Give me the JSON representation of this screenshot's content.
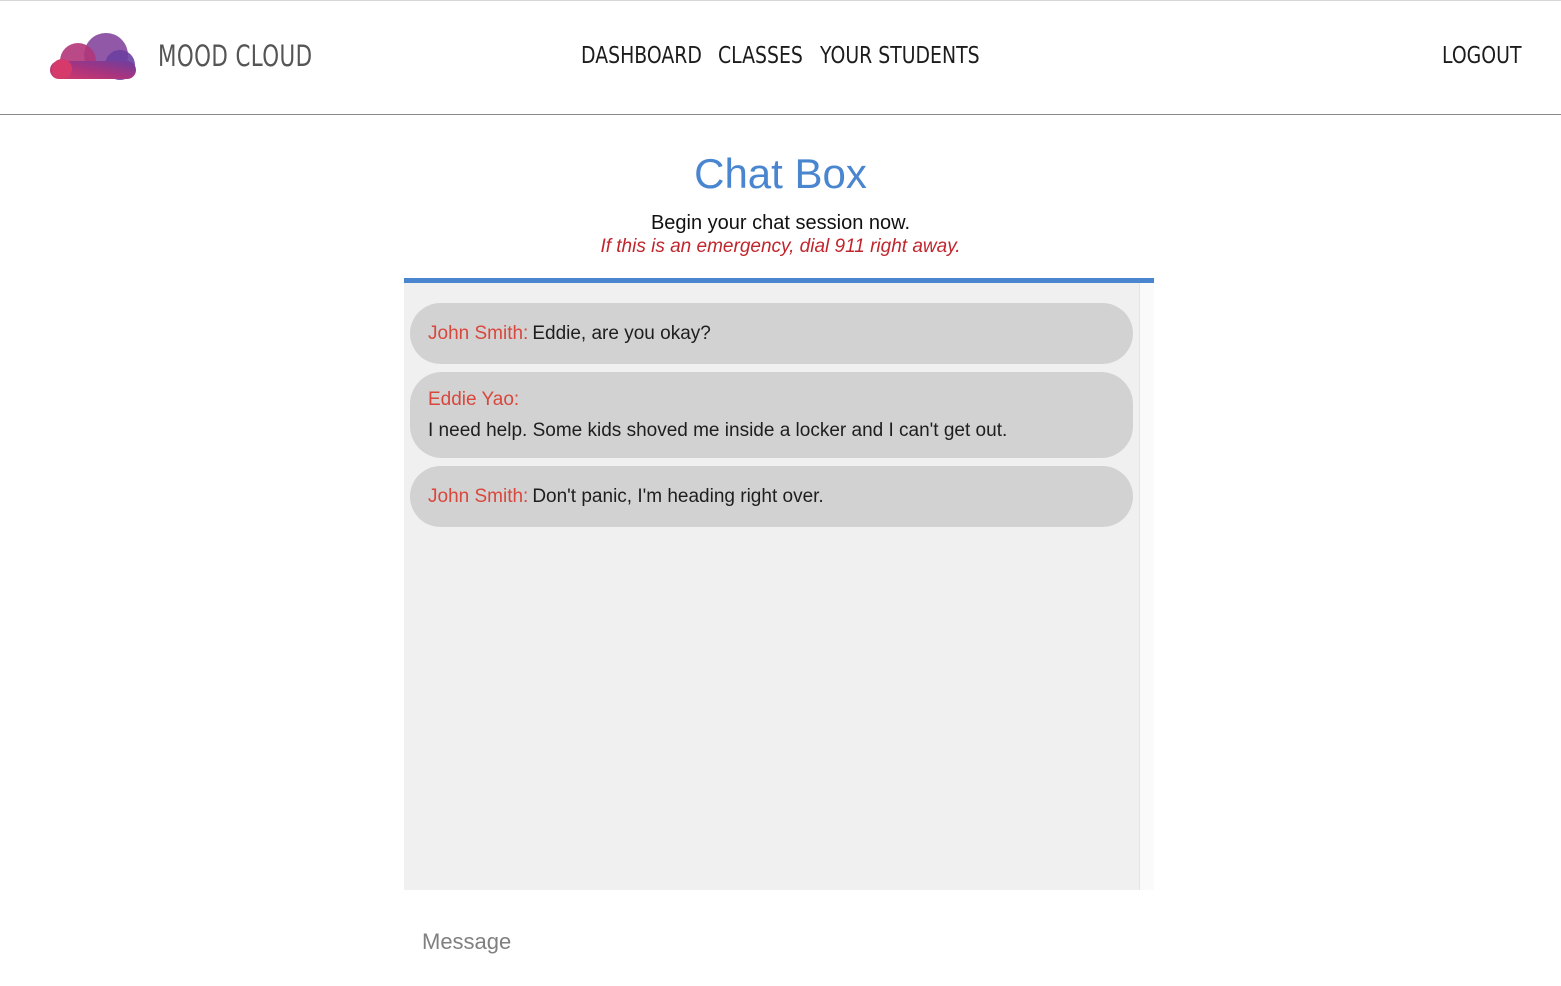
{
  "header": {
    "brand": "MOOD CLOUD",
    "logo_icon": "cloud-icon",
    "logo_colors": [
      "#8e2f8c",
      "#d63a6a",
      "#6b3fa0"
    ],
    "nav": [
      {
        "label": "DASHBOARD"
      },
      {
        "label": "CLASSES"
      },
      {
        "label": "YOUR STUDENTS"
      }
    ],
    "logout_label": "LOGOUT"
  },
  "page": {
    "title": "Chat Box",
    "subtitle": "Begin your chat session now.",
    "emergency_notice": "If this is an emergency, dial 911 right away."
  },
  "chat": {
    "messages": [
      {
        "sender": "John Smith:",
        "text": "Eddie, are you okay?"
      },
      {
        "sender": "Eddie Yao:",
        "text": "I need help. Some kids shoved me inside a locker and I can't get out."
      },
      {
        "sender": "John Smith:",
        "text": "Don't panic, I'm heading right over."
      }
    ],
    "input_placeholder": "Message"
  },
  "colors": {
    "accent": "#4a86d0",
    "sender": "#d9473c",
    "emergency": "#c0262d",
    "bubble": "#d2d2d2",
    "chat_bg": "#f0f0f0"
  }
}
